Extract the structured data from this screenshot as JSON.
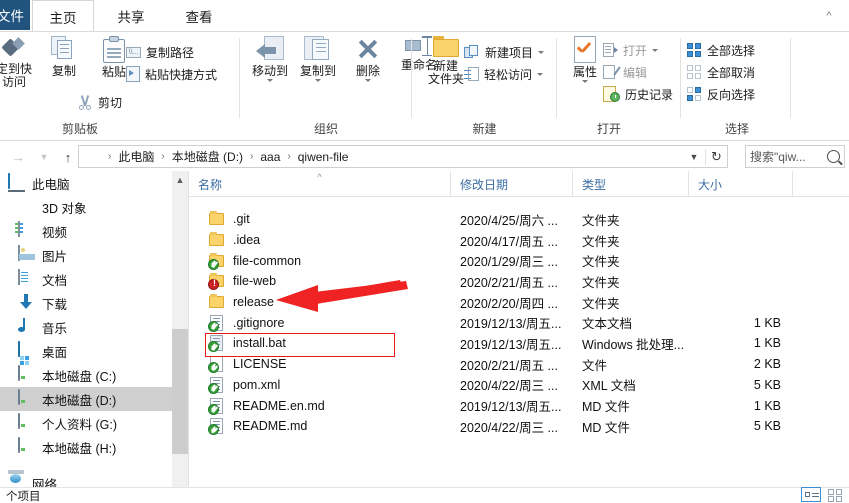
{
  "window": {
    "tabs": [
      {
        "id": "file",
        "label": "文件"
      },
      {
        "id": "home",
        "label": "主页"
      },
      {
        "id": "share",
        "label": "共享"
      },
      {
        "id": "view",
        "label": "查看"
      }
    ],
    "active_tab": "主页",
    "collapse_ribbon_icon": "chevron-up-icon"
  },
  "ribbon": {
    "groups": [
      {
        "id": "clipboard",
        "label": "剪贴板"
      },
      {
        "id": "organize",
        "label": "组织"
      },
      {
        "id": "new",
        "label": "新建"
      },
      {
        "id": "open",
        "label": "打开"
      },
      {
        "id": "select",
        "label": "选择"
      }
    ],
    "clipboard": {
      "pin_label": "固定到快速访问",
      "pin_label_line1": "定到快",
      "pin_label_line2": "访问",
      "copy_label": "复制",
      "paste_label": "粘贴",
      "copy_path_label": "复制路径",
      "paste_shortcut_label": "粘贴快捷方式",
      "cut_label": "剪切"
    },
    "organize": {
      "move_to_label": "移动到",
      "copy_to_label": "复制到",
      "delete_label": "删除",
      "rename_label": "重命名"
    },
    "new": {
      "new_folder_line1": "新建",
      "new_folder_line2": "文件夹",
      "new_item_label": "新建项目",
      "easy_access_label": "轻松访问"
    },
    "open": {
      "properties_label": "属性",
      "open_label": "打开",
      "edit_label": "编辑",
      "history_label": "历史记录"
    },
    "select": {
      "select_all_label": "全部选择",
      "select_none_label": "全部取消",
      "invert_label": "反向选择"
    }
  },
  "addressbar": {
    "back_icon": "arrow-left-icon",
    "forward_icon": "arrow-right-icon",
    "recent_icon": "chevron-down-icon",
    "up_icon": "arrow-up-icon",
    "folder_icon": "folder-icon",
    "crumbs": [
      "此电脑",
      "本地磁盘 (D:)",
      "aaa",
      "qiwen-file"
    ],
    "separator": "›",
    "dropdown_icon": "chevron-down-icon",
    "refresh_icon": "refresh-icon",
    "search_placeholder": "搜索\"qiw...",
    "search_icon": "magnifier-icon"
  },
  "sidebar": {
    "selected": "本地磁盘 (D:)",
    "items": [
      {
        "label": "此电脑",
        "icon": "this-pc-icon",
        "indent": 0
      },
      {
        "label": "3D 对象",
        "icon": "3d-objects-icon",
        "indent": 1
      },
      {
        "label": "视频",
        "icon": "videos-icon",
        "indent": 1
      },
      {
        "label": "图片",
        "icon": "pictures-icon",
        "indent": 1
      },
      {
        "label": "文档",
        "icon": "documents-icon",
        "indent": 1
      },
      {
        "label": "下载",
        "icon": "downloads-icon",
        "indent": 1
      },
      {
        "label": "音乐",
        "icon": "music-icon",
        "indent": 1
      },
      {
        "label": "桌面",
        "icon": "desktop-icon",
        "indent": 1
      },
      {
        "label": "本地磁盘 (C:)",
        "icon": "drive-c-icon",
        "indent": 1
      },
      {
        "label": "本地磁盘 (D:)",
        "icon": "drive-icon",
        "indent": 1
      },
      {
        "label": "个人资料 (G:)",
        "icon": "drive-icon",
        "indent": 1
      },
      {
        "label": "本地磁盘 (H:)",
        "icon": "drive-icon",
        "indent": 1
      },
      {
        "label": "网络",
        "icon": "network-icon",
        "indent": 0
      }
    ],
    "scrollbar": {
      "up_icon": "chevron-up-icon",
      "down_icon": "chevron-down-icon"
    }
  },
  "filelist": {
    "columns": [
      {
        "key": "name",
        "label": "名称",
        "sorted": true,
        "sort_icon": "sort-asc-icon"
      },
      {
        "key": "date",
        "label": "修改日期"
      },
      {
        "key": "type",
        "label": "类型"
      },
      {
        "key": "size",
        "label": "大小"
      }
    ],
    "rows": [
      {
        "name": ".git",
        "date": "2020/4/25/周六 ...",
        "type": "文件夹",
        "size": "",
        "icon": "folder-icon",
        "overlay": ""
      },
      {
        "name": ".idea",
        "date": "2020/4/17/周五 ...",
        "type": "文件夹",
        "size": "",
        "icon": "folder-icon",
        "overlay": ""
      },
      {
        "name": "file-common",
        "date": "2020/1/29/周三 ...",
        "type": "文件夹",
        "size": "",
        "icon": "folder-icon",
        "overlay": "green-check-overlay"
      },
      {
        "name": "file-web",
        "date": "2020/2/21/周五 ...",
        "type": "文件夹",
        "size": "",
        "icon": "folder-icon",
        "overlay": "red-error-overlay"
      },
      {
        "name": "release",
        "date": "2020/2/20/周四 ...",
        "type": "文件夹",
        "size": "",
        "icon": "folder-icon",
        "overlay": ""
      },
      {
        "name": ".gitignore",
        "date": "2019/12/13/周五...",
        "type": "文本文档",
        "size": "1 KB",
        "icon": "text-file-icon",
        "overlay": "green-check-overlay"
      },
      {
        "name": "install.bat",
        "date": "2019/12/13/周五...",
        "type": "Windows 批处理...",
        "size": "1 KB",
        "icon": "batch-file-icon",
        "overlay": "green-check-overlay"
      },
      {
        "name": "LICENSE",
        "date": "2020/2/21/周五 ...",
        "type": "文件",
        "size": "2 KB",
        "icon": "generic-file-icon",
        "overlay": "green-check-overlay"
      },
      {
        "name": "pom.xml",
        "date": "2020/4/22/周三 ...",
        "type": "XML 文档",
        "size": "5 KB",
        "icon": "xml-file-icon",
        "overlay": "green-check-overlay"
      },
      {
        "name": "README.en.md",
        "date": "2019/12/13/周五...",
        "type": "MD 文件",
        "size": "1 KB",
        "icon": "md-file-icon",
        "overlay": "green-check-overlay"
      },
      {
        "name": "README.md",
        "date": "2020/4/22/周三 ...",
        "type": "MD 文件",
        "size": "5 KB",
        "icon": "md-file-icon",
        "overlay": "green-check-overlay"
      }
    ],
    "highlighted_row": "install.bat",
    "pointed_row": "release"
  },
  "annotations": {
    "rect_color": "#e21b1b",
    "arrow_color": "#ef2323",
    "rect_target": "install.bat",
    "arrow_target": "release"
  },
  "statusbar": {
    "count_text": "个项目",
    "details_view_icon": "details-view-icon",
    "large-icons_view_icon": "large-icons-view-icon"
  }
}
